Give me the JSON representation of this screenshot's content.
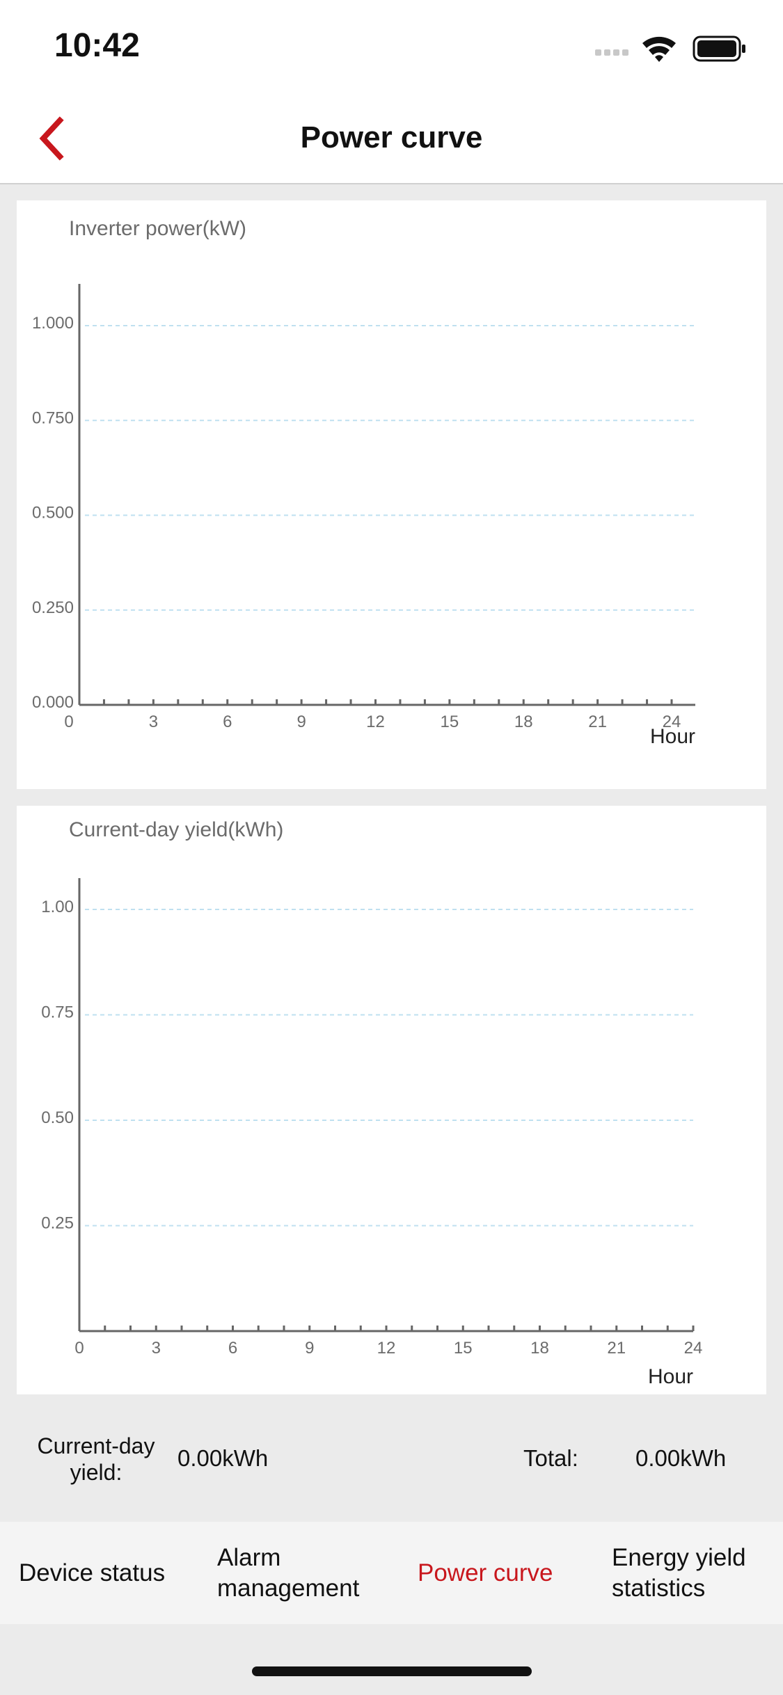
{
  "status_bar": {
    "time": "10:42"
  },
  "nav": {
    "title": "Power curve",
    "back_icon": "chevron-left-icon",
    "accent_color": "#c8171d"
  },
  "charts": {
    "power": {
      "title": "Inverter power(kW)",
      "xlabel": "Hour"
    },
    "yield": {
      "title": "Current-day yield(kWh)",
      "xlabel": "Hour"
    }
  },
  "chart_data": [
    {
      "type": "line",
      "title": "Inverter power(kW)",
      "xlabel": "Hour",
      "ylabel": "",
      "x_ticks": [
        "0",
        "3",
        "6",
        "9",
        "12",
        "15",
        "18",
        "21",
        "24"
      ],
      "y_ticks": [
        "0.000",
        "0.250",
        "0.500",
        "0.750",
        "1.000"
      ],
      "xlim": [
        0,
        24
      ],
      "ylim": [
        0,
        1
      ],
      "grid": true,
      "series": []
    },
    {
      "type": "bar",
      "title": "Current-day yield(kWh)",
      "xlabel": "Hour",
      "ylabel": "",
      "x_ticks": [
        "0",
        "3",
        "6",
        "9",
        "12",
        "15",
        "18",
        "21",
        "24"
      ],
      "y_ticks": [
        "0.25",
        "0.50",
        "0.75",
        "1.00"
      ],
      "xlim": [
        0,
        24
      ],
      "ylim": [
        0,
        1
      ],
      "grid": true,
      "series": []
    }
  ],
  "summary": {
    "day_yield_label": "Current-day yield:",
    "day_yield_value": "0.00kWh",
    "total_label": "Total:",
    "total_value": "0.00kWh"
  },
  "tabs": [
    {
      "label": "Device status",
      "active": false
    },
    {
      "label": "Alarm management",
      "active": false
    },
    {
      "label": "Power curve",
      "active": true
    },
    {
      "label": "Energy yield statistics",
      "active": false
    }
  ]
}
